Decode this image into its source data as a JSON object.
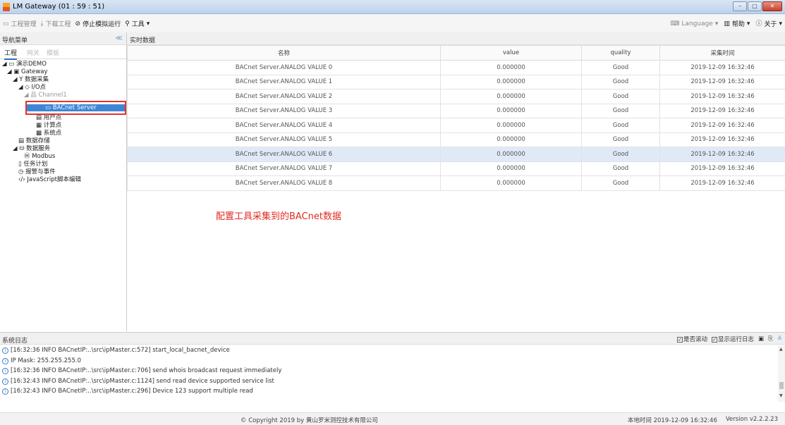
{
  "window": {
    "title": "LM Gateway (01 : 59 : 51)",
    "minimize": "–",
    "maximize": "□",
    "close": "✕"
  },
  "menu": {
    "project_mgmt": "工程管理",
    "download_project": "下载工程",
    "stop_simulation": "停止模拟运行",
    "tools": "工具",
    "language": "Language",
    "help": "帮助",
    "about": "关于"
  },
  "nav": {
    "header": "导航菜单",
    "collapse": "≪",
    "tabs": [
      "工程",
      "网关",
      "模板"
    ],
    "tree": {
      "demo": "演示DEMO",
      "gateway": "Gateway",
      "data_collection": "数据采集",
      "io_points": "I/O点",
      "channel": "Channel1",
      "bacnet_server": "BACnet Server",
      "user_points": "用户点",
      "calc_points": "计算点",
      "system_points": "系统点",
      "data_storage": "数据存储",
      "data_service": "数据服务",
      "modbus": "Modbus",
      "task_plan": "任务计划",
      "alarm_event": "报警与事件",
      "js_editor": "JavaScript脚本编辑"
    }
  },
  "realtime": {
    "header": "实时数据",
    "columns": [
      "名称",
      "value",
      "quality",
      "采集时间"
    ],
    "rows": [
      [
        "BACnet Server.ANALOG VALUE 0",
        "0.000000",
        "Good",
        "2019-12-09 16:32:46"
      ],
      [
        "BACnet Server.ANALOG VALUE 1",
        "0.000000",
        "Good",
        "2019-12-09 16:32:46"
      ],
      [
        "BACnet Server.ANALOG VALUE 2",
        "0.000000",
        "Good",
        "2019-12-09 16:32:46"
      ],
      [
        "BACnet Server.ANALOG VALUE 3",
        "0.000000",
        "Good",
        "2019-12-09 16:32:46"
      ],
      [
        "BACnet Server.ANALOG VALUE 4",
        "0.000000",
        "Good",
        "2019-12-09 16:32:46"
      ],
      [
        "BACnet Server.ANALOG VALUE 5",
        "0.000000",
        "Good",
        "2019-12-09 16:32:46"
      ],
      [
        "BACnet Server.ANALOG VALUE 6",
        "0.000000",
        "Good",
        "2019-12-09 16:32:46"
      ],
      [
        "BACnet Server.ANALOG VALUE 7",
        "0.000000",
        "Good",
        "2019-12-09 16:32:46"
      ],
      [
        "BACnet Server.ANALOG VALUE 8",
        "0.000000",
        "Good",
        "2019-12-09 16:32:46"
      ]
    ],
    "selected_row_index": 6
  },
  "annotation": "配置工具采集到的BACnet数据",
  "log": {
    "header": "系统日志",
    "autoscroll": "是否滚动",
    "show_runtime": "显示运行日志",
    "lines": [
      "[16:32:36 INFO BACnetIP:..\\src\\ipMaster.c:572] start_local_bacnet_device",
      "IP Mask: 255.255.255.0",
      "[16:32:36 INFO BACnetIP:..\\src\\ipMaster.c:706] send whois broadcast request immediately",
      "[16:32:43 INFO BACnetIP:..\\src\\ipMaster.c:1124] send read device supported service list",
      "[16:32:43 INFO BACnetIP:..\\src\\ipMaster.c:296] Device 123 support multiple read"
    ]
  },
  "status": {
    "copyright": "© Copyright 2019 by 黄山罗米测控技术有限公司",
    "local_time": "本地时间 2019-12-09 16:32:46",
    "version": "Version v2.2.2.23"
  },
  "colors": {
    "accent": "#3d86d6",
    "annotation": "#e02a24",
    "highlight_box": "#e4342c"
  }
}
